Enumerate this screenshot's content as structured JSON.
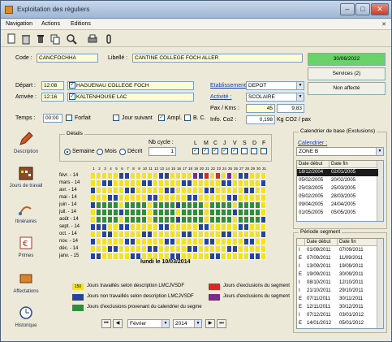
{
  "window": {
    "title": "Exploitation des réguliers"
  },
  "menu": [
    "Navigation",
    "Actions",
    "Editions"
  ],
  "header": {
    "code_label": "Code :",
    "code_value": "CANCFOCHHA",
    "libelle_label": "Libellé :",
    "libelle_value": "CANTINE COLLEGE FOCH ALLER",
    "date": "30/06/2022",
    "services": "Services (2)",
    "affect": "Non affecté"
  },
  "route": {
    "depart_label": "Départ :",
    "depart_time": "12:08",
    "depart_place": "HAGUENAU COLLEGE FOCH",
    "arrivee_label": "Arrivée :",
    "arrivee_time": "12:16",
    "arrivee_place": "KALTENHOUSE LAC",
    "temps_label": "Temps :",
    "temps_value": "00:00",
    "forfait": "Forfait",
    "jour_suivant": "Jour suivant",
    "ampl": "Ampl.",
    "bc": "B. C.",
    "etab_label": "Etablissement :",
    "etab_value": "DEPOT",
    "activite_label": "Activité :",
    "activite_value": "SCOLAIRE",
    "pax_label": "Pax / Kms :",
    "pax_value": "45",
    "kms_value": "9,83",
    "co2_label": "Info. Co2 :",
    "co2_value": "0,198",
    "co2_unit": "Kg CO2 / pax"
  },
  "details": {
    "title": "Détails",
    "modes": [
      "Semaine",
      "Mois",
      "Décrit"
    ],
    "nb_cycle_label": "Nb cycle :",
    "nb_cycle_value": "1",
    "days": [
      "L",
      "M",
      "C",
      "J",
      "V",
      "S",
      "D",
      "F"
    ],
    "days_checked": [
      true,
      true,
      true,
      true,
      true,
      false,
      false,
      false
    ]
  },
  "calendar": {
    "months": [
      "févr. - 14",
      "mars - 14",
      "avr. - 14",
      "mai - 14",
      "juin - 14",
      "juil. - 14",
      "août - 14",
      "sept. - 14",
      "oct. - 14",
      "nov. - 14",
      "déc. - 14",
      "janv. - 15"
    ],
    "day_count": 31,
    "current_date_label": "lundi le 10/03/2014",
    "colors": {
      "worked": "#f2e12a",
      "not_worked": "#24449e",
      "excluded": "#2e8f3b",
      "seg_excl": "#d62a24",
      "seg_excl2": "#7b2a8c"
    }
  },
  "legend": {
    "worked_count": "150",
    "worked_text": "Jours travaillés selon description LMCJVSDF",
    "not_worked_text": "Jours non travaillés selon description LMCJVSDF",
    "excluded_text": "Jours d'exclusions provenant du calendrier du segme",
    "seg1_text": "Jours d'exclusions du segment",
    "seg2_text": "Jours d'exclusions du segment"
  },
  "nav": {
    "month": "Février",
    "year": "2014"
  },
  "sidebar": [
    "Description",
    "Jours de travail",
    "Itinéraires",
    "Primes",
    "Affectations",
    "Historique"
  ],
  "base_calendar": {
    "title": "Calendrier de base (Exclusions)",
    "calendrier_label": "Calendrier :",
    "calendrier_value": "ZONE B",
    "head": [
      "Date début",
      "Date fin"
    ],
    "rows": [
      [
        "18/12/2004",
        "02/01/2005"
      ],
      [
        "05/02/2005",
        "20/02/2005"
      ],
      [
        "25/03/2005",
        "25/03/2005"
      ],
      [
        "05/02/2005",
        "28/03/2005"
      ],
      [
        "09/04/2005",
        "24/04/2005"
      ],
      [
        "01/05/2005",
        "05/05/2005"
      ]
    ]
  },
  "segment_period": {
    "title": "Période segment",
    "head": [
      "Date début",
      "Date fin"
    ],
    "rows": [
      [
        "I",
        "01/09/2011",
        "07/09/2011"
      ],
      [
        "E",
        "07/09/2011",
        "11/09/2011"
      ],
      [
        "I",
        "13/09/2011",
        "19/09/2011"
      ],
      [
        "E",
        "19/09/2011",
        "30/09/2011"
      ],
      [
        "I",
        "08/10/2011",
        "12/10/2011"
      ],
      [
        "I",
        "21/10/2011",
        "29/10/2011"
      ],
      [
        "E",
        "07/11/2011",
        "30/11/2011"
      ],
      [
        "E",
        "12/11/2011",
        "30/12/2011"
      ],
      [
        "I",
        "07/12/2011",
        "03/01/2012"
      ],
      [
        "E",
        "14/01/2012",
        "05/01/2012"
      ]
    ]
  }
}
